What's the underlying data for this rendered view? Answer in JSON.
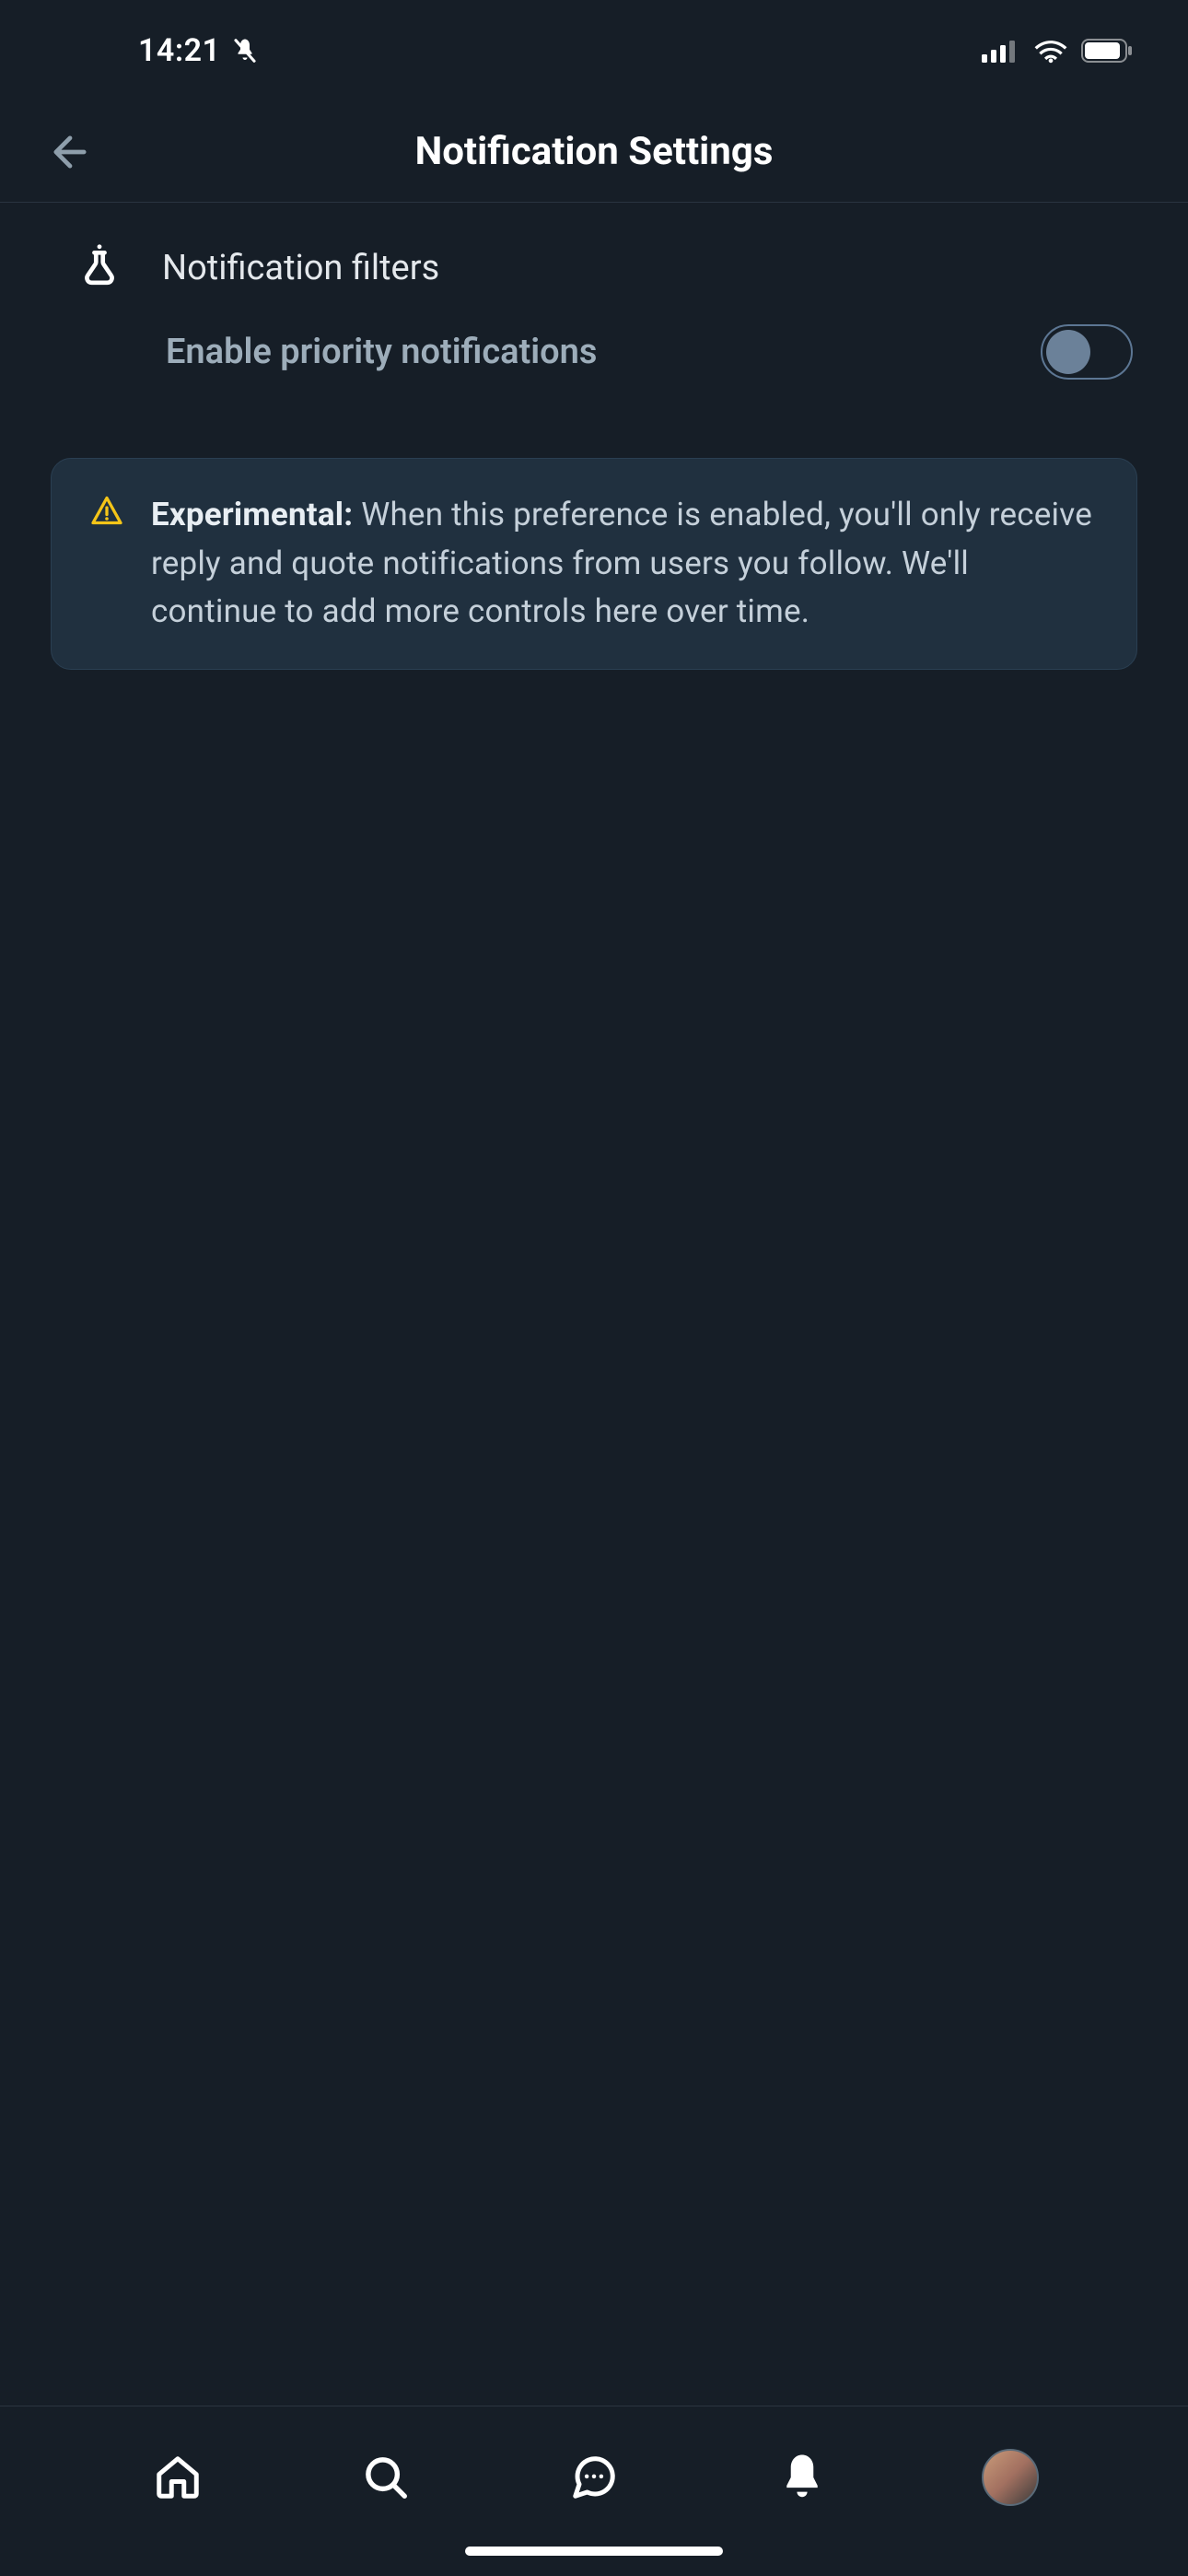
{
  "status_bar": {
    "time": "14:21"
  },
  "header": {
    "title": "Notification Settings"
  },
  "section": {
    "title": "Notification filters"
  },
  "setting": {
    "label": "Enable priority notifications",
    "toggle_on": false
  },
  "info": {
    "prefix": "Experimental:",
    "text": "When this preference is enabled, you'll only receive reply and quote notifications from users you follow. We'll continue to add more controls here over time."
  },
  "colors": {
    "bg": "#161e27",
    "info_bg": "#20303f",
    "warning": "#f5c518",
    "muted": "#9dadba"
  }
}
